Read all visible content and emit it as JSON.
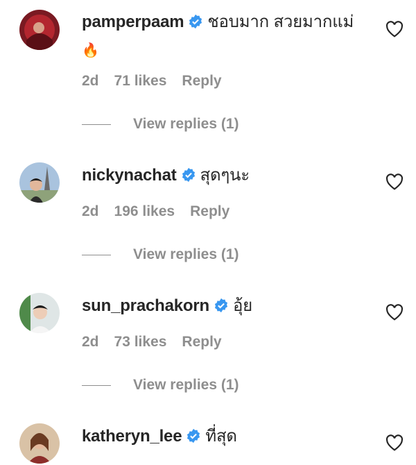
{
  "comments": [
    {
      "username": "pamperpaam",
      "text": "ชอบมาก สวยมากแม่",
      "emoji": "🔥",
      "time": "2d",
      "likes": "71 likes",
      "reply": "Reply",
      "view_replies": "View replies (1)"
    },
    {
      "username": "nickynachat",
      "text": "สุดๆนะ",
      "time": "2d",
      "likes": "196 likes",
      "reply": "Reply",
      "view_replies": "View replies (1)"
    },
    {
      "username": "sun_prachakorn",
      "text": "อุ้ย",
      "time": "2d",
      "likes": "73 likes",
      "reply": "Reply",
      "view_replies": "View replies (1)"
    },
    {
      "username": "katheryn_lee",
      "text": "ที่สุด"
    }
  ],
  "colors": {
    "text": "#262626",
    "muted": "#8e8e8e",
    "verified": "#3897f0"
  },
  "icons": {
    "verified": "verified-badge-icon",
    "like": "heart-outline-icon"
  }
}
